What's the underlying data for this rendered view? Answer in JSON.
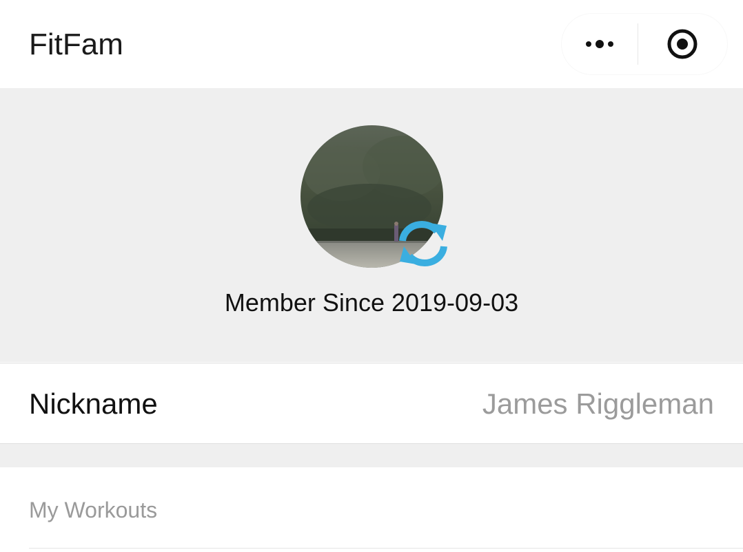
{
  "header": {
    "app_title": "FitFam",
    "more_icon": "more-dots-icon",
    "target_icon": "target-icon"
  },
  "profile": {
    "member_since": "Member Since 2019-09-03",
    "avatar_icon": "user-avatar",
    "refresh_icon": "refresh-icon",
    "accent_color": "#3aaee0"
  },
  "nickname": {
    "label": "Nickname",
    "value": "James Riggleman"
  },
  "workouts": {
    "title": "My Workouts"
  }
}
